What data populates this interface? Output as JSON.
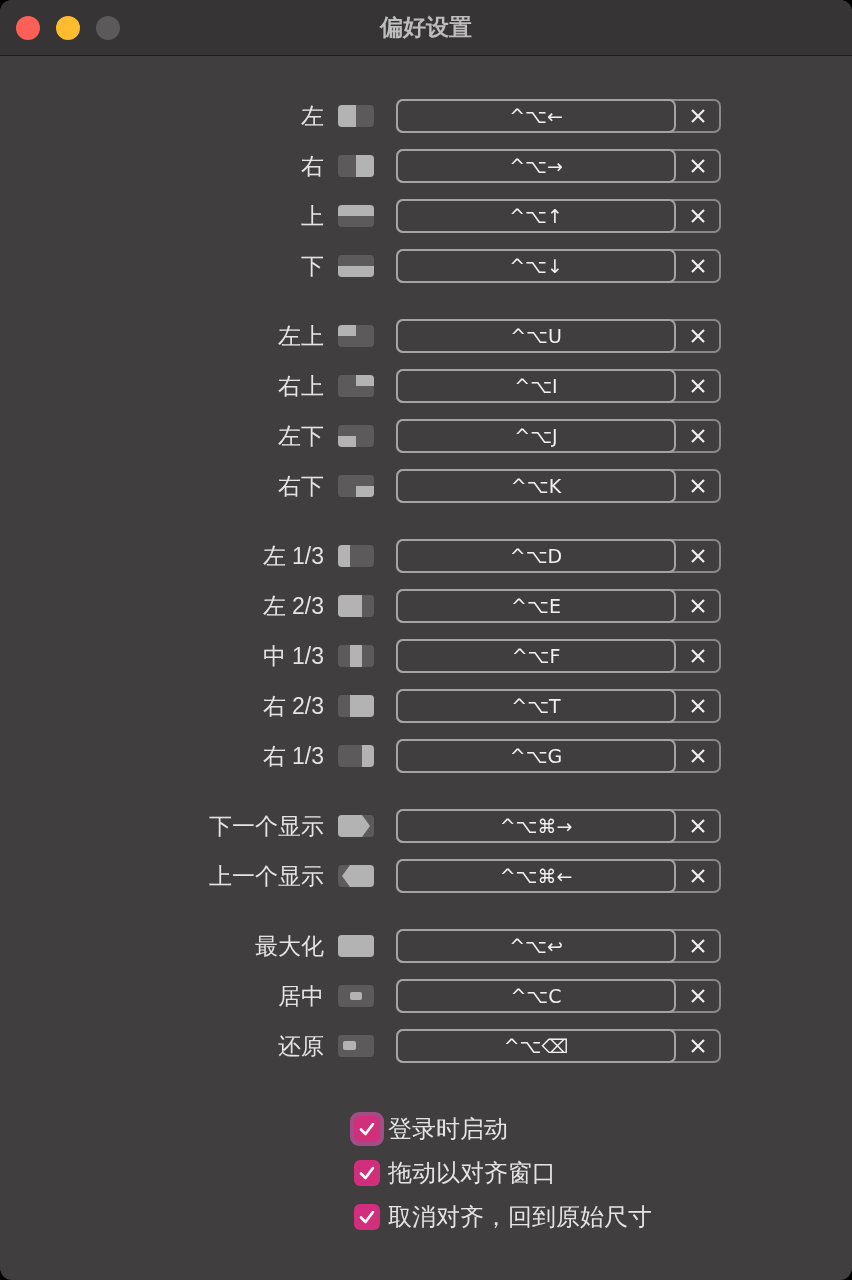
{
  "window": {
    "title": "偏好设置",
    "controls": [
      {
        "kind": "close",
        "enabled": true
      },
      {
        "kind": "minimize",
        "enabled": true
      },
      {
        "kind": "zoom",
        "enabled": false
      }
    ]
  },
  "groups": [
    {
      "items": [
        {
          "label": "左",
          "kind": "left",
          "shortcut": "^⌥←"
        },
        {
          "label": "右",
          "kind": "right",
          "shortcut": "^⌥→"
        },
        {
          "label": "上",
          "kind": "top",
          "shortcut": "^⌥↑"
        },
        {
          "label": "下",
          "kind": "bottom",
          "shortcut": "^⌥↓"
        }
      ]
    },
    {
      "items": [
        {
          "label": "左上",
          "kind": "top-left",
          "shortcut": "^⌥U"
        },
        {
          "label": "右上",
          "kind": "top-right",
          "shortcut": "^⌥I"
        },
        {
          "label": "左下",
          "kind": "bottom-left",
          "shortcut": "^⌥J"
        },
        {
          "label": "右下",
          "kind": "bottom-right",
          "shortcut": "^⌥K"
        }
      ]
    },
    {
      "items": [
        {
          "label": "左 1/3",
          "kind": "left-third",
          "shortcut": "^⌥D"
        },
        {
          "label": "左 2/3",
          "kind": "left-two-thirds",
          "shortcut": "^⌥E"
        },
        {
          "label": "中 1/3",
          "kind": "center-third",
          "shortcut": "^⌥F"
        },
        {
          "label": "右 2/3",
          "kind": "right-two-thirds",
          "shortcut": "^⌥T"
        },
        {
          "label": "右 1/3",
          "kind": "right-third",
          "shortcut": "^⌥G"
        }
      ]
    },
    {
      "items": [
        {
          "label": "下一个显示",
          "kind": "next-display",
          "shortcut": "^⌥⌘→"
        },
        {
          "label": "上一个显示",
          "kind": "previous-display",
          "shortcut": "^⌥⌘←"
        }
      ]
    },
    {
      "items": [
        {
          "label": "最大化",
          "kind": "maximize",
          "shortcut": "^⌥↩"
        },
        {
          "label": "居中",
          "kind": "center",
          "shortcut": "^⌥C"
        },
        {
          "label": "还原",
          "kind": "restore",
          "shortcut": "^⌥⌫"
        }
      ]
    }
  ],
  "options": [
    {
      "label": "登录时启动",
      "checked": true,
      "focused": true
    },
    {
      "label": "拖动以对齐窗口",
      "checked": true,
      "focused": false
    },
    {
      "label": "取消对齐，回到原始尺寸",
      "checked": true,
      "focused": false
    }
  ]
}
